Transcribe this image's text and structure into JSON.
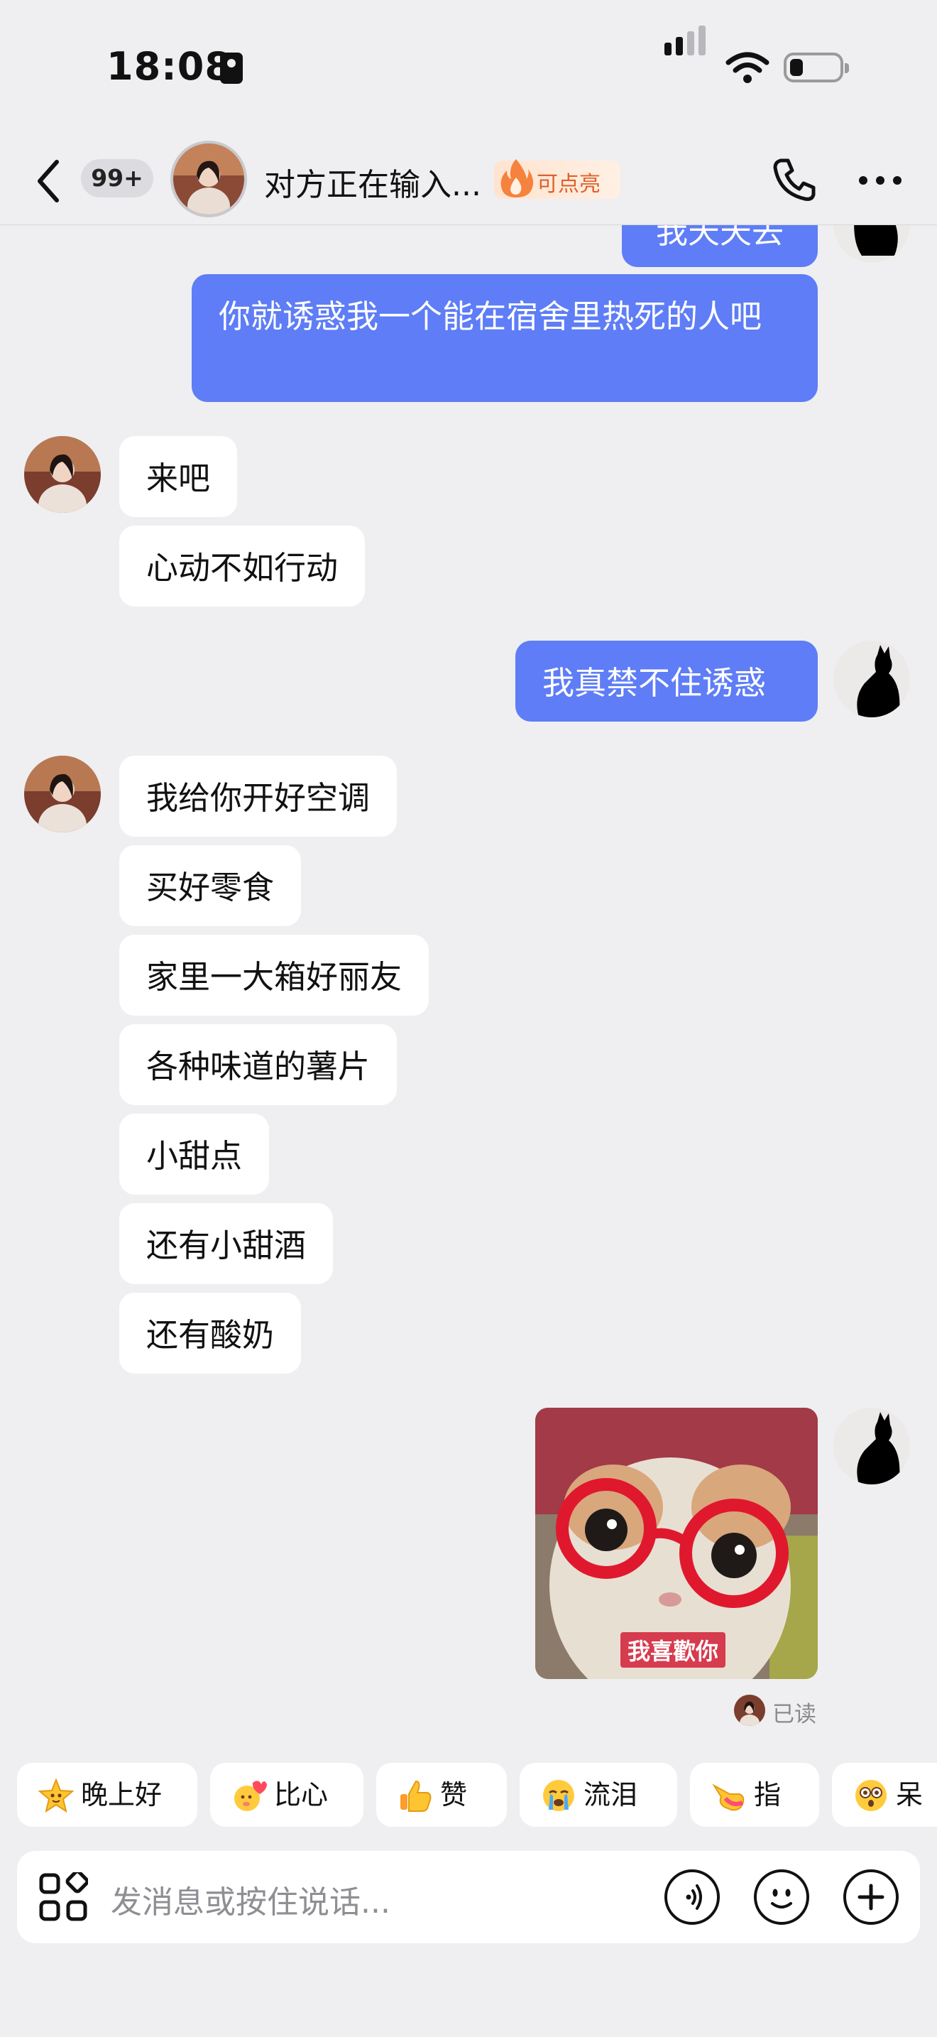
{
  "status_bar": {
    "time": "18:08",
    "icons": [
      "contact-card-icon",
      "cellular-signal-icon",
      "wifi-icon",
      "battery-icon"
    ]
  },
  "header": {
    "back_icon": "chevron-left-icon",
    "unread_count": "99+",
    "peer_status": "对方正在输入...",
    "badge_label": "可点亮",
    "badge_icon": "flame-icon",
    "call_icon": "phone-icon",
    "more_icon": "more-dots-icon"
  },
  "messages": {
    "partial_out": "我天天去",
    "out_1": "你就诱惑我一个能在宿舍里热死的人吧",
    "in_group_1": [
      "来吧",
      "心动不如行动"
    ],
    "out_2": "我真禁不住诱惑",
    "in_group_2": [
      "我给你开好空调",
      "买好零食",
      "家里一大箱好丽友",
      "各种味道的薯片",
      "小甜点",
      "还有小甜酒",
      "还有酸奶"
    ],
    "sticker_caption": "我喜歡你",
    "read_receipt": "已读"
  },
  "quick_replies": [
    {
      "label": "晚上好",
      "icon": "star-face-icon"
    },
    {
      "label": "比心",
      "icon": "heart-hands-icon"
    },
    {
      "label": "赞",
      "icon": "thumbs-up-icon"
    },
    {
      "label": "流泪",
      "icon": "crying-face-icon"
    },
    {
      "label": "指",
      "icon": "pointing-hand-icon"
    },
    {
      "label": "呆",
      "icon": "dazed-face-icon"
    }
  ],
  "input_bar": {
    "placeholder": "发消息或按住说话...",
    "apps_icon": "apps-grid-icon",
    "voice_icon": "voice-wave-icon",
    "emoji_icon": "smiley-icon",
    "plus_icon": "plus-circle-icon"
  },
  "colors": {
    "background": "#efeff1",
    "outgoing_bubble": "#5e7df6",
    "incoming_bubble": "#ffffff",
    "flame_badge": "#e0602a"
  }
}
